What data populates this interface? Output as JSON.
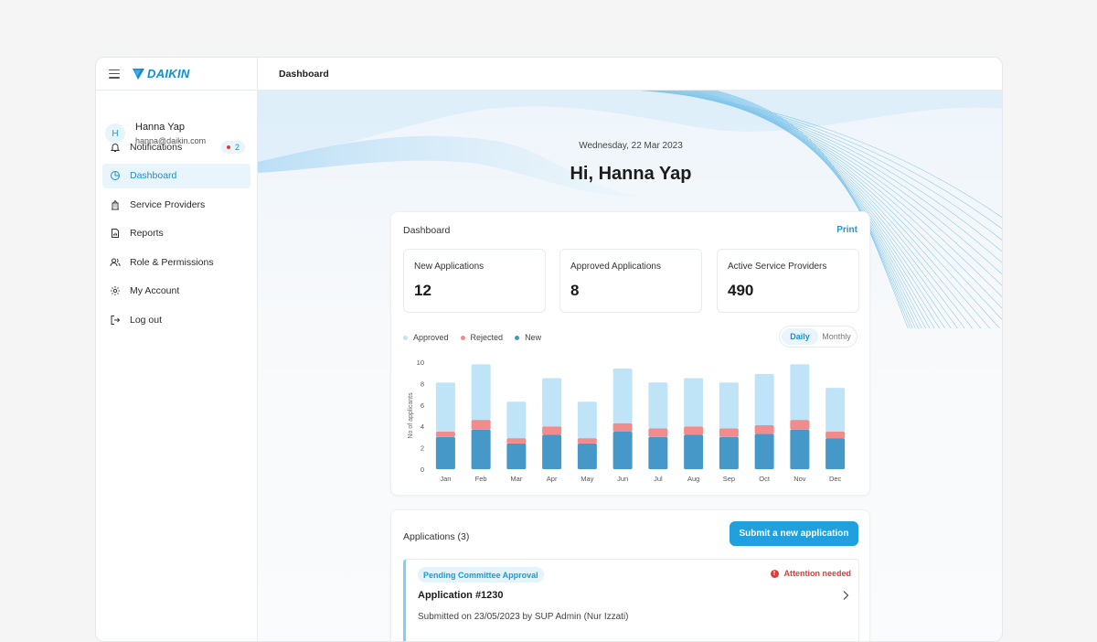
{
  "app": {
    "brand": "DAIKIN",
    "page_title": "Dashboard"
  },
  "user": {
    "initial": "H",
    "name": "Hanna Yap",
    "email": "hanna@daikin.com"
  },
  "sidebar": {
    "items": [
      {
        "label": "Notifications",
        "icon": "bell-icon",
        "badge": "2"
      },
      {
        "label": "Dashboard",
        "icon": "pie-chart-icon",
        "active": true
      },
      {
        "label": "Service Providers",
        "icon": "building-icon"
      },
      {
        "label": "Reports",
        "icon": "report-icon"
      },
      {
        "label": "Role & Permissions",
        "icon": "users-icon"
      },
      {
        "label": "My Account",
        "icon": "gear-icon"
      },
      {
        "label": "Log out",
        "icon": "logout-icon"
      }
    ]
  },
  "hero": {
    "date": "Wednesday, 22 Mar 2023",
    "greeting": "Hi, Hanna Yap"
  },
  "dashboard": {
    "title": "Dashboard",
    "print_label": "Print",
    "stats": [
      {
        "label": "New Applications",
        "value": "12"
      },
      {
        "label": "Approved Applications",
        "value": "8"
      },
      {
        "label": "Active Service Providers",
        "value": "490"
      }
    ],
    "toggle": {
      "daily": "Daily",
      "monthly": "Monthly",
      "selected": "Daily"
    }
  },
  "colors": {
    "accent": "#20a0dc",
    "approved": "#bfe4f8",
    "rejected": "#f28b8b",
    "new": "#4698c8"
  },
  "chart_data": {
    "type": "bar",
    "stacked": true,
    "categories": [
      "Jan",
      "Feb",
      "Mar",
      "Apr",
      "May",
      "Jun",
      "Jul",
      "Aug",
      "Sep",
      "Oct",
      "Nov",
      "Dec"
    ],
    "series": [
      {
        "name": "New",
        "values": [
          3,
          3.7,
          2.4,
          3.2,
          2.4,
          3.5,
          3,
          3.2,
          3,
          3.3,
          3.7,
          2.9
        ]
      },
      {
        "name": "Rejected",
        "values": [
          0.5,
          0.9,
          0.5,
          0.8,
          0.5,
          0.8,
          0.8,
          0.8,
          0.8,
          0.8,
          0.9,
          0.6
        ]
      },
      {
        "name": "Approved",
        "values": [
          4.6,
          5.2,
          3.4,
          4.5,
          3.4,
          5.1,
          4.3,
          4.5,
          4.3,
          4.8,
          5.2,
          4.1
        ]
      }
    ],
    "legend_order": [
      "Approved",
      "Rejected",
      "New"
    ],
    "ylabel": "No of applicants",
    "ylim": [
      0,
      10
    ],
    "yticks": [
      0,
      2,
      4,
      6,
      8,
      10
    ],
    "grid": false,
    "legend_placement": "top-left"
  },
  "applications": {
    "title": "Applications (3)",
    "submit_label": "Submit a new application",
    "items": [
      {
        "status": "Pending Committee Approval",
        "attention": "Attention needed",
        "id": "Application #1230",
        "submitted": "Submitted on 23/05/2023 by SUP Admin (Nur Izzati)"
      }
    ]
  }
}
